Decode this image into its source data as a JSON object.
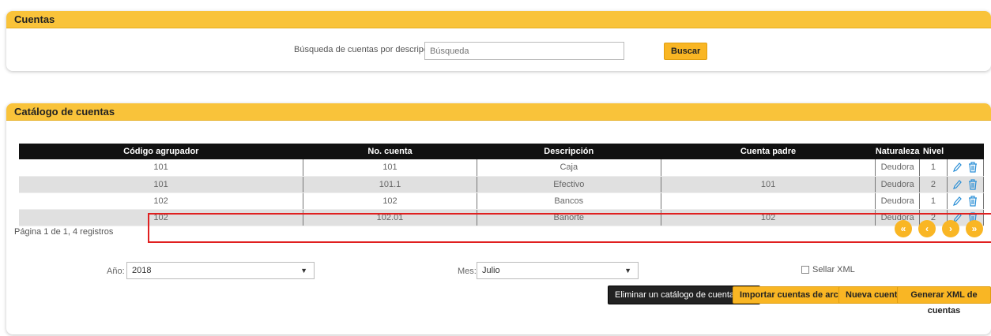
{
  "search_panel": {
    "title": "Cuentas",
    "label": "Búsqueda de cuentas por descripción:",
    "placeholder": "Búsqueda",
    "button": "Buscar"
  },
  "catalog_panel": {
    "title": "Catálogo de cuentas",
    "columns": [
      "Código agrupador",
      "No. cuenta",
      "Descripción",
      "Cuenta padre",
      "Naturaleza",
      "Nivel"
    ],
    "rows": [
      {
        "codigo": "101",
        "cuenta": "101",
        "descripcion": "Caja",
        "padre": "",
        "naturaleza": "Deudora",
        "nivel": "1"
      },
      {
        "codigo": "101",
        "cuenta": "101.1",
        "descripcion": "Efectivo",
        "padre": "101",
        "naturaleza": "Deudora",
        "nivel": "2"
      },
      {
        "codigo": "102",
        "cuenta": "102",
        "descripcion": "Bancos",
        "padre": "",
        "naturaleza": "Deudora",
        "nivel": "1"
      },
      {
        "codigo": "102",
        "cuenta": "102.01",
        "descripcion": "Banorte",
        "padre": "102",
        "naturaleza": "Deudora",
        "nivel": "2"
      }
    ],
    "page_info": "Página 1 de 1, 4 registros",
    "pager": [
      "«",
      "‹",
      "›",
      "»"
    ],
    "filters": {
      "year_label": "Año:",
      "year_value": "2018",
      "month_label": "Mes:",
      "month_value": "Julio",
      "seal_label": "Sellar XML"
    },
    "buttons": {
      "delete_sat": "Eliminar un catálogo de cuenta SAT",
      "import": "Importar cuentas de archivo",
      "new": "Nueva cuenta",
      "generate_xml": "Generar XML de cuentas"
    }
  },
  "colors": {
    "accent": "#f9c33a",
    "button": "#f9b624",
    "icon": "#2b8fd6",
    "highlight": "#e02020"
  },
  "icons": {
    "edit": "pencil-icon",
    "delete": "trash-icon"
  }
}
